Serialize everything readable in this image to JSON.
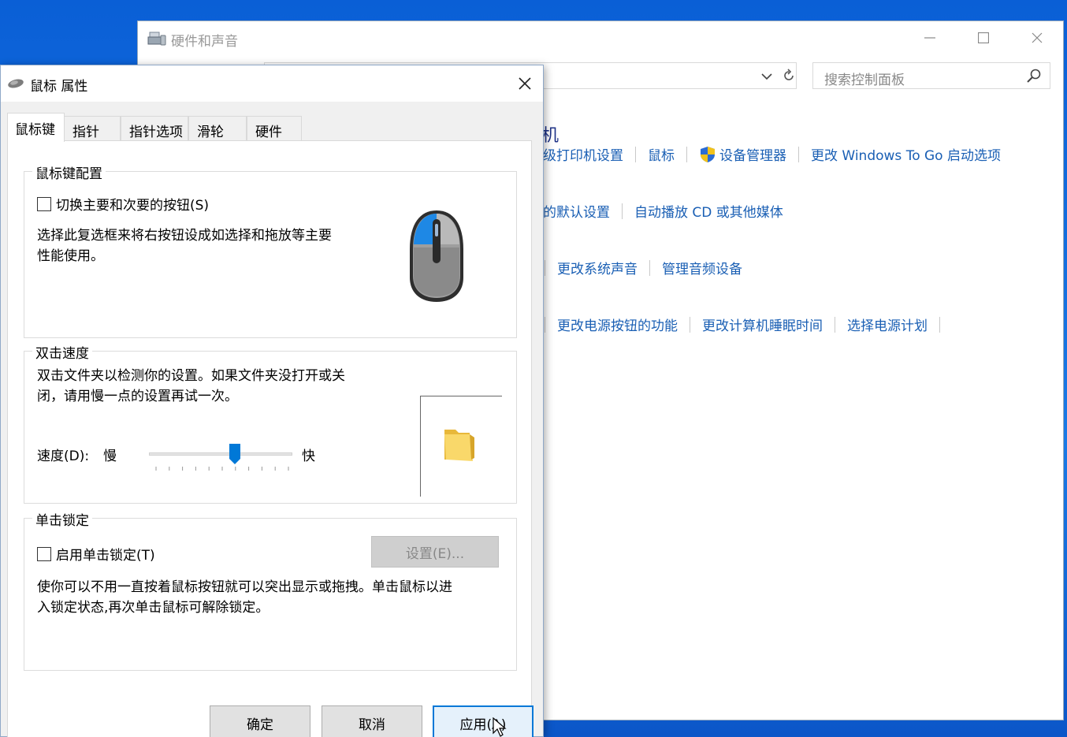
{
  "control_panel": {
    "title": "硬件和声音",
    "search_placeholder": "搜索控制面板",
    "heading_fragment": "机",
    "rows": [
      {
        "links": [
          "级打印机设置",
          "鼠标",
          "设备管理器",
          "更改 Windows To Go 启动选项"
        ]
      },
      {
        "links": [
          "的默认设置",
          "自动播放 CD 或其他媒体"
        ]
      },
      {
        "links": [
          "更改系统声音",
          "管理音频设备"
        ]
      },
      {
        "links": [
          "更改电源按钮的功能",
          "更改计算机睡眠时间",
          "选择电源计划"
        ]
      }
    ]
  },
  "dialog": {
    "title": "鼠标 属性",
    "tabs": [
      "鼠标键",
      "指针",
      "指针选项",
      "滑轮",
      "硬件"
    ],
    "active_tab": "鼠标键",
    "button_config": {
      "label": "鼠标键配置",
      "checkbox_label": "切换主要和次要的按钮(S)",
      "checked": false,
      "description_line1": "选择此复选框来将右按钮设成如选择和拖放等主要",
      "description_line2": "性能使用。"
    },
    "double_click": {
      "label": "双击速度",
      "description_line1": "双击文件夹以检测你的设置。如果文件夹没打开或关",
      "description_line2": "闭，请用慢一点的设置再试一次。",
      "speed_label": "速度(D):",
      "slow_label": "慢",
      "fast_label": "快",
      "speed_value": 0.6
    },
    "click_lock": {
      "label": "单击锁定",
      "checkbox_label": "启用单击锁定(T)",
      "checked": false,
      "settings_button": "设置(E)...",
      "description_line1": "使你可以不用一直按着鼠标按钮就可以突出显示或拖拽。单击鼠标以进",
      "description_line2": "入锁定状态,再次单击鼠标可解除锁定。"
    },
    "buttons": {
      "ok": "确定",
      "cancel": "取消",
      "apply": "应用(A)"
    }
  },
  "colors": {
    "link": "#1a5fb4",
    "heading": "#1e3287",
    "desktop": "#0a5fd6",
    "accent": "#0078d7"
  }
}
